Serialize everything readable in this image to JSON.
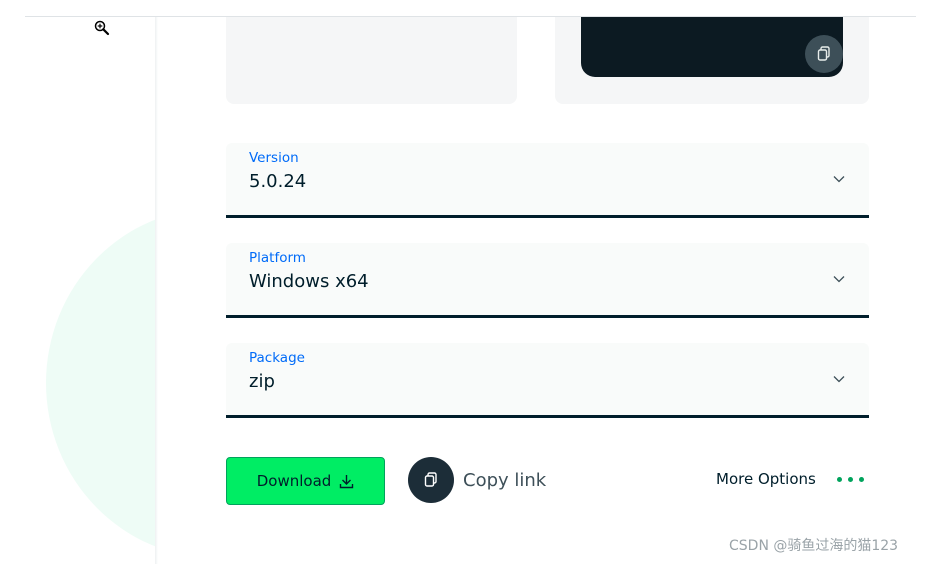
{
  "icons": {
    "zoom": "zoom-in-icon",
    "copy": "copy-icon",
    "chevron": "chevron-down-icon",
    "download": "download-icon",
    "more": "ellipsis-icon"
  },
  "colors": {
    "accent_green": "#00ed64",
    "dark": "#001e2b",
    "label_blue": "#016bf8",
    "dots_green": "#00a35c"
  },
  "selects": {
    "version": {
      "label": "Version",
      "value": "5.0.24"
    },
    "platform": {
      "label": "Platform",
      "value": "Windows x64"
    },
    "package": {
      "label": "Package",
      "value": "zip"
    }
  },
  "actions": {
    "download_label": "Download",
    "copy_link_label": "Copy link",
    "more_options_label": "More Options"
  },
  "watermark": "CSDN @骑鱼过海的猫123"
}
